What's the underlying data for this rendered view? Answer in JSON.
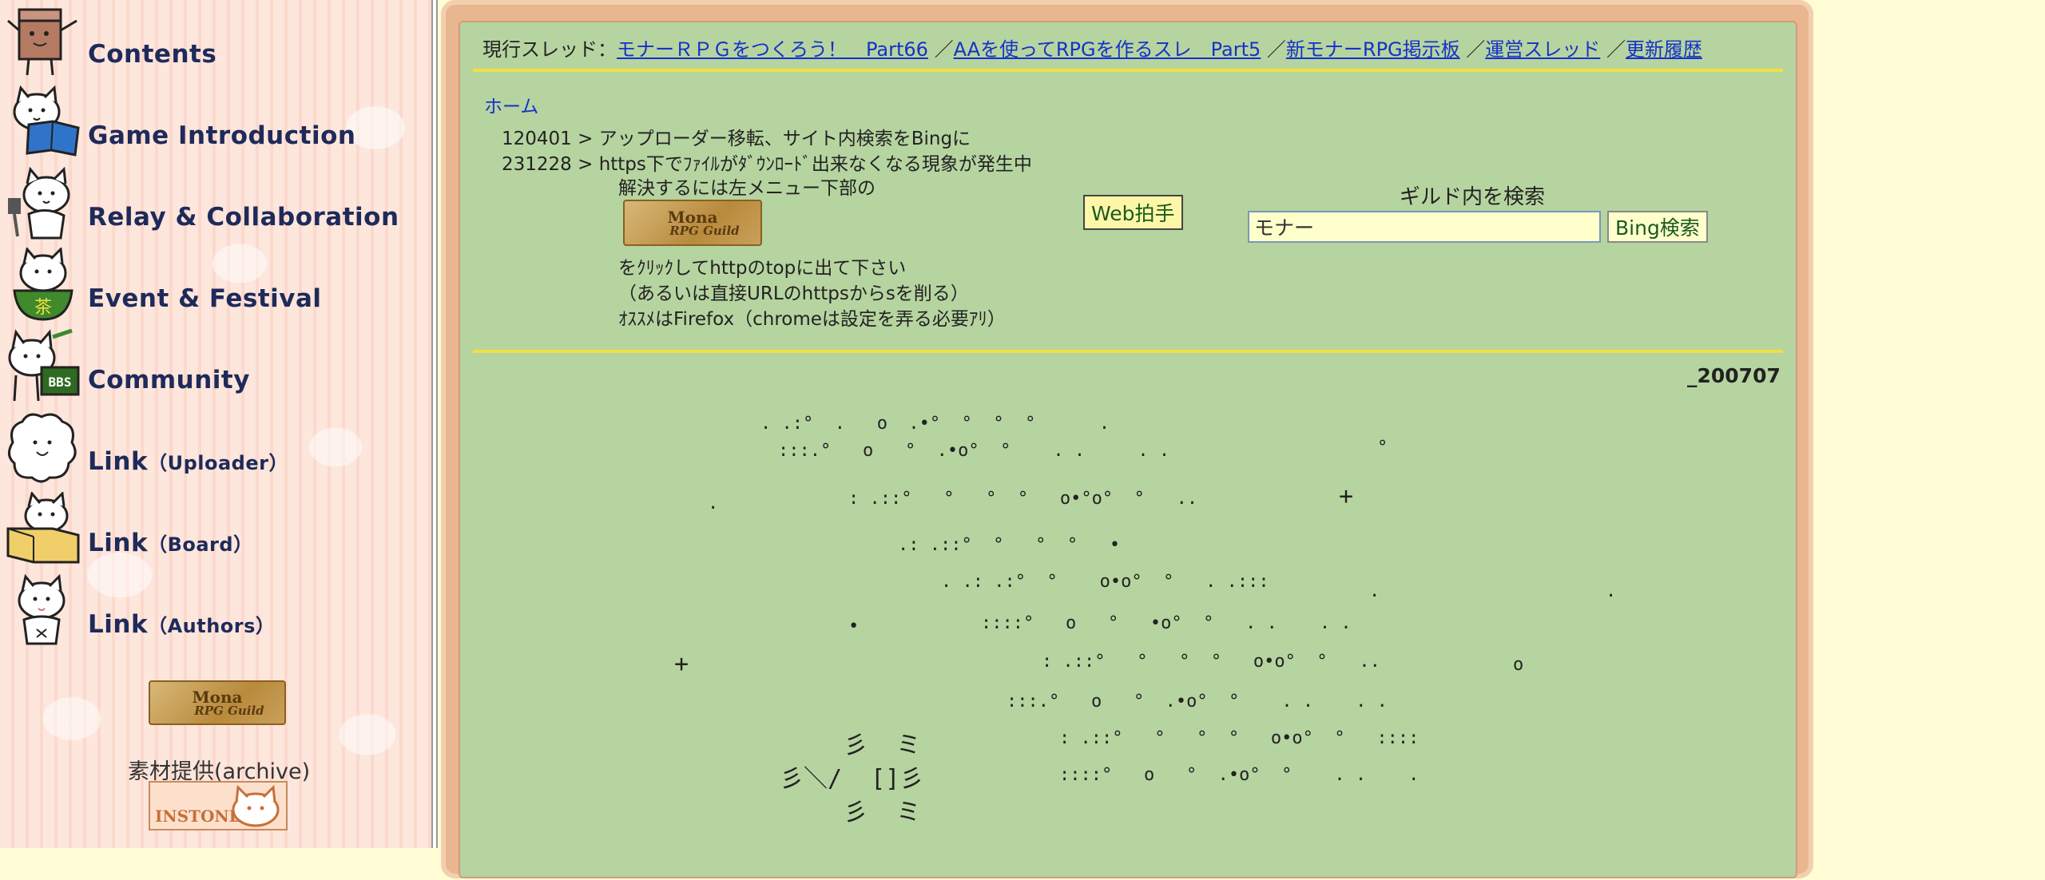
{
  "sidebar": {
    "items": [
      {
        "label": "Contents",
        "sub": "",
        "icon": "box-mascot-icon"
      },
      {
        "label": "Game Introduction",
        "sub": "",
        "icon": "reading-cat-icon"
      },
      {
        "label": "Relay & Collaboration",
        "sub": "",
        "icon": "hammer-cat-icon"
      },
      {
        "label": "Event & Festival",
        "sub": "",
        "icon": "tea-bowl-cat-icon"
      },
      {
        "label": "Community",
        "sub": "",
        "icon": "bbs-cat-icon"
      },
      {
        "label": "Link",
        "sub": "（Uploader）",
        "icon": "fluffy-cat-icon"
      },
      {
        "label": "Link",
        "sub": "（Board）",
        "icon": "box-cat-icon"
      },
      {
        "label": "Link",
        "sub": "（Authors）",
        "icon": "standing-cat-icon"
      }
    ],
    "logo_text": [
      "Mona",
      "RPG Guild"
    ],
    "archive_label": "素材提供(archive)",
    "instone_text": "INSTONE"
  },
  "threads": {
    "prefix": "現行スレッド：",
    "links": [
      "モナーＲＰＧをつくろう！　Part66",
      "AAを使ってRPGを作るスレ　Part5",
      "新モナーRPG掲示板",
      "運営スレッド",
      "更新履歴"
    ],
    "separator": "／"
  },
  "home": "ホーム",
  "news": [
    "120401 > アップローダー移転、サイト内検索をBingに",
    "231228 > https下でﾌｧｲﾙがﾀﾞｳﾝﾛｰﾄﾞ出来なくなる現象が発生中"
  ],
  "notes": [
    "解決するには左メニュー下部の",
    "をｸﾘｯｸしてhttpのtopに出て下さい",
    "（あるいは直接URLのhttpsからsを削る）",
    "ｵｽｽﾒはFirefox（chromeは設定を弄る必要ｱﾘ）"
  ],
  "web_clap": "Web拍手",
  "search": {
    "title": "ギルド内を検索",
    "value": "モナー",
    "button": "Bing検索"
  },
  "date_label": "_200707",
  "colors": {
    "content_bg": "#b6d4a0",
    "frame": "#e8b68f",
    "link": "#1532c8",
    "divider": "#f0e040",
    "page_bg": "#fffcd6"
  }
}
